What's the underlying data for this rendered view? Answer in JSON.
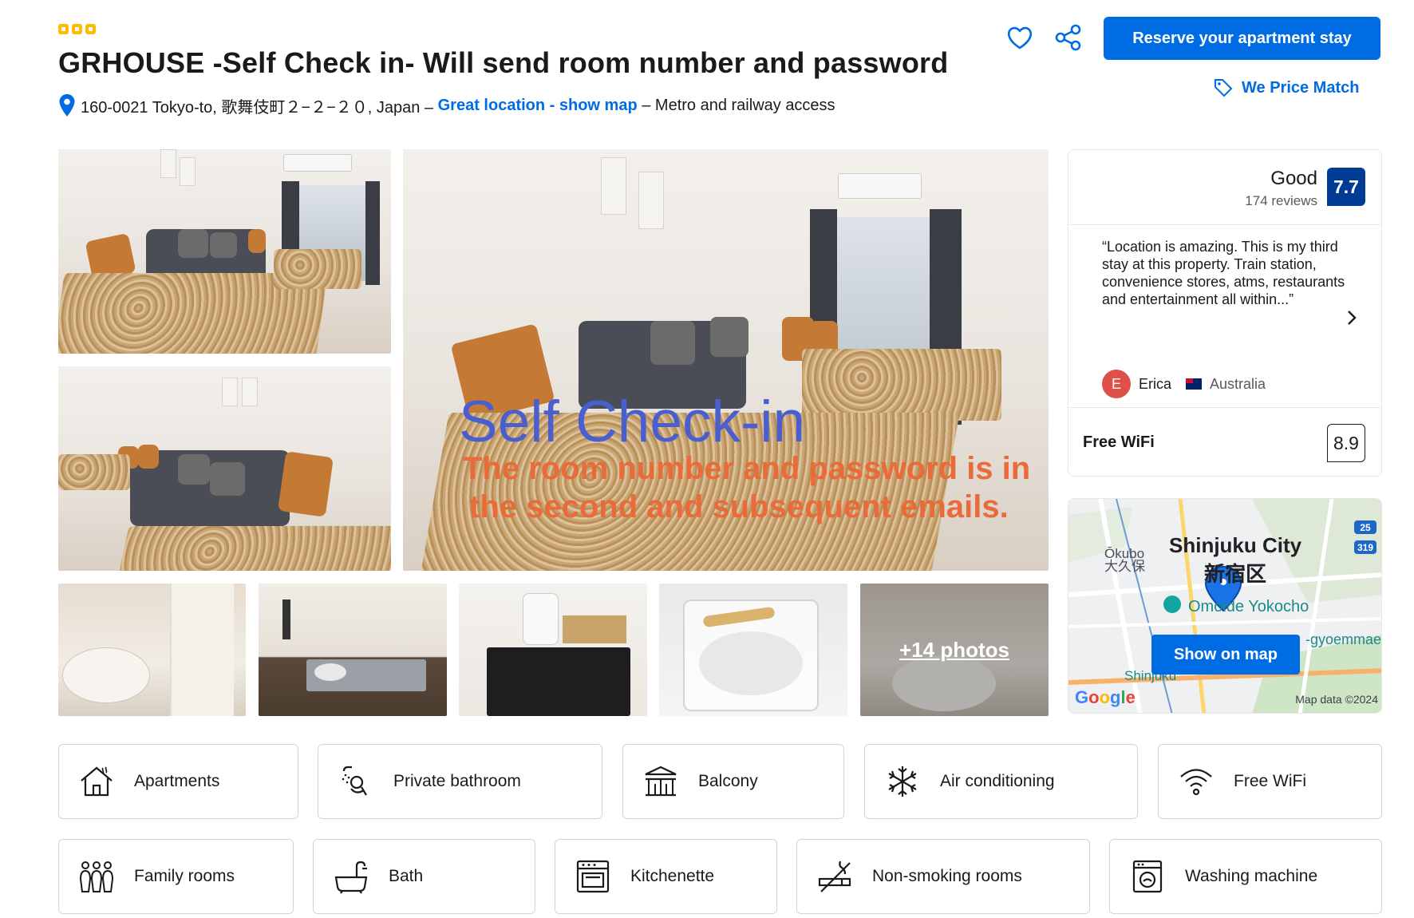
{
  "property": {
    "star_rating": 3,
    "title": "GRHOUSE -Self Check in- Will send room number and password",
    "address": "160-0021 Tokyo-to, 歌舞伎町２−２−２０, Japan –",
    "location_link": "Great location - show map",
    "location_suffix": "– Metro and railway access"
  },
  "actions": {
    "save_icon": "heart-icon",
    "share_icon": "share-icon",
    "reserve_label": "Reserve your apartment stay",
    "price_match_label": "We Price Match"
  },
  "gallery": {
    "main_overlay_title": "Self Check-in",
    "main_overlay_line1": "The room number and password is in",
    "main_overlay_line2": "the second and subsequent emails.",
    "more_photos_label": "+14 photos"
  },
  "review": {
    "rating_word": "Good",
    "review_count": "174 reviews",
    "score": "7.7",
    "quote": "“Location is amazing. This is my third stay at this property. Train station, convenience stores, atms, restaurants and entertainment all within...”",
    "reviewer_initial": "E",
    "reviewer_name": "Erica",
    "reviewer_country": "Australia",
    "wifi_label": "Free WiFi",
    "wifi_score": "8.9"
  },
  "map": {
    "city_label": "Shinjuku City",
    "city_kanji": "新宿区",
    "okubo_label": "Ōkubo",
    "okubo_kanji": "大久保",
    "omoide_label": "Omoide Yokocho",
    "gyoemmae_label": "-gyoemmae",
    "shinjuku_label": "Shinjuku",
    "road_25": "25",
    "road_319": "319",
    "google_label": "Google",
    "credit": "Map data ©2024",
    "button_label": "Show on map"
  },
  "facilities": [
    {
      "label": "Apartments",
      "icon": "house-icon"
    },
    {
      "label": "Private bathroom",
      "icon": "shower-icon"
    },
    {
      "label": "Balcony",
      "icon": "balcony-icon"
    },
    {
      "label": "Air conditioning",
      "icon": "snowflake-icon"
    },
    {
      "label": "Free WiFi",
      "icon": "wifi-icon"
    },
    {
      "label": "Family rooms",
      "icon": "family-icon"
    },
    {
      "label": "Bath",
      "icon": "bathtub-icon"
    },
    {
      "label": "Kitchenette",
      "icon": "oven-icon"
    },
    {
      "label": "Non-smoking rooms",
      "icon": "no-smoking-icon"
    },
    {
      "label": "Washing machine",
      "icon": "washing-machine-icon"
    }
  ],
  "colors": {
    "brand_blue": "#006ce4",
    "score_navy": "#003b95",
    "star_yellow": "#febb02",
    "overlay_blue": "#4a5fcf",
    "overlay_orange": "#ea6b3a"
  }
}
